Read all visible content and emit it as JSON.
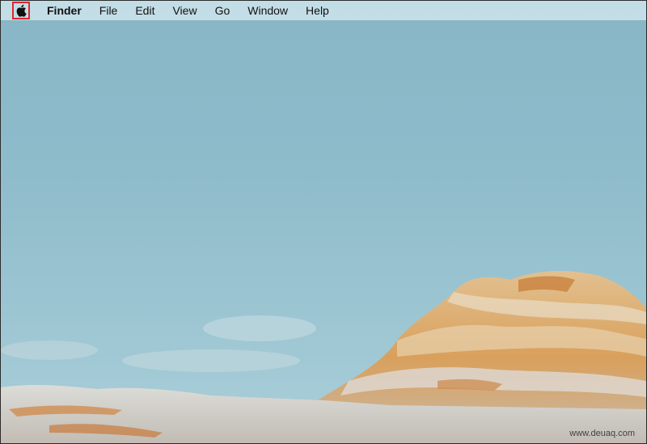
{
  "menubar": {
    "apple_icon": "apple-logo-icon",
    "app_name": "Finder",
    "items": [
      "File",
      "Edit",
      "View",
      "Go",
      "Window",
      "Help"
    ]
  },
  "highlight_color": "#e0282d",
  "watermark": "www.deuaq.com"
}
